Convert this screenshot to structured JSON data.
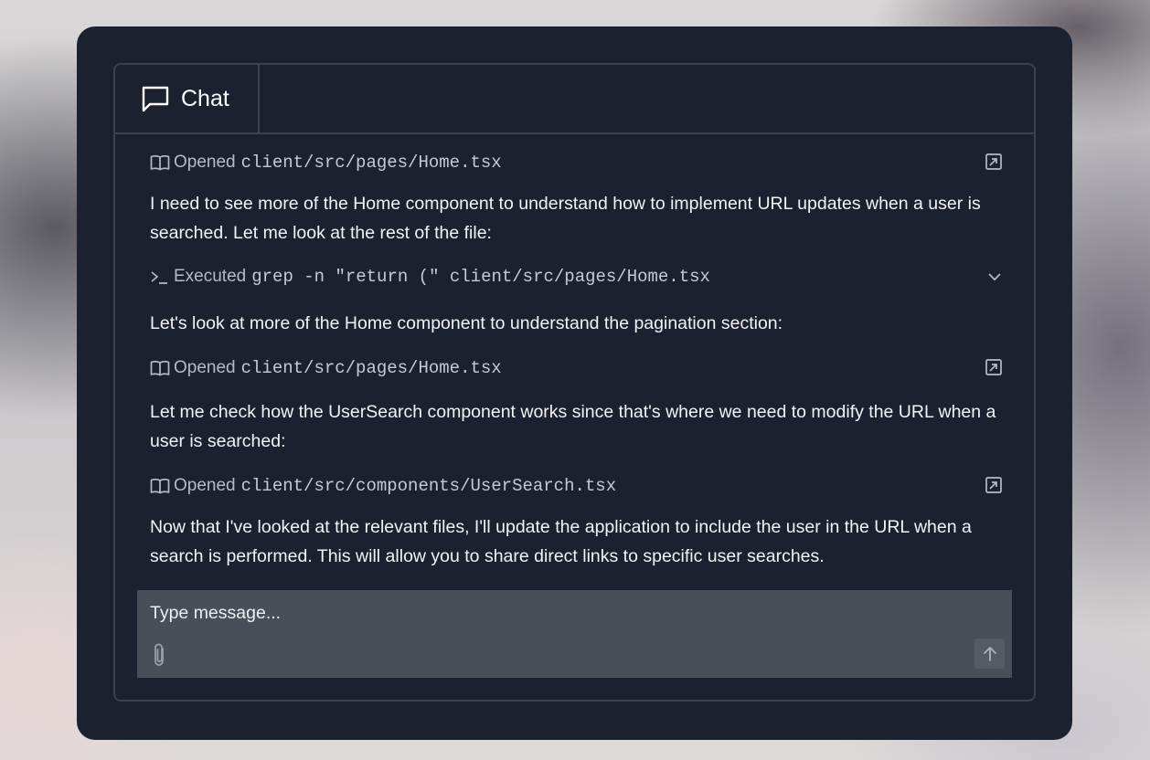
{
  "tab": {
    "label": "Chat",
    "icon": "chat-bubble-icon"
  },
  "feed": [
    {
      "kind": "action",
      "icon": "book-open-icon",
      "label": "Opened",
      "code": "client/src/pages/Home.tsx",
      "right_icon": "open-external-icon"
    },
    {
      "kind": "message",
      "text": "I need to see more of the Home component to understand how to implement URL updates when a user is searched. Let me look at the rest of the file:"
    },
    {
      "kind": "action",
      "icon": "terminal-icon",
      "label": "Executed",
      "code": "grep -n \"return (\" client/src/pages/Home.tsx",
      "right_icon": "chevron-down-icon"
    },
    {
      "kind": "message",
      "text": "Let's look at more of the Home component to understand the pagination section:"
    },
    {
      "kind": "action",
      "icon": "book-open-icon",
      "label": "Opened",
      "code": "client/src/pages/Home.tsx",
      "right_icon": "open-external-icon"
    },
    {
      "kind": "message",
      "text": "Let me check how the UserSearch component works since that's where we need to modify the URL when a user is searched:"
    },
    {
      "kind": "action",
      "icon": "book-open-icon",
      "label": "Opened",
      "code": "client/src/components/UserSearch.tsx",
      "right_icon": "open-external-icon"
    },
    {
      "kind": "message",
      "text": "Now that I've looked at the relevant files, I'll update the application to include the user in the URL when a search is performed. This will allow you to share direct links to specific user searches."
    }
  ],
  "composer": {
    "placeholder": "Type message...",
    "attach_icon": "paperclip-icon",
    "send_icon": "arrow-up-icon"
  }
}
